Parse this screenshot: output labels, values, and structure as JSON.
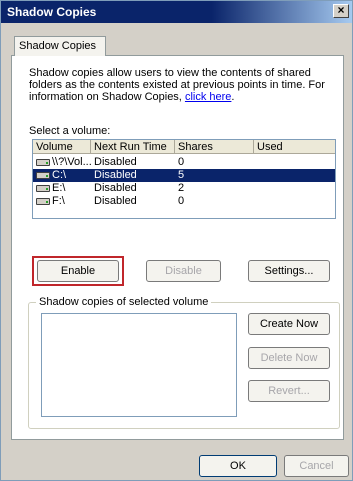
{
  "window": {
    "title": "Shadow Copies",
    "close_glyph": "×"
  },
  "tab": {
    "label": "Shadow Copies"
  },
  "description": {
    "text": "Shadow copies allow users to view the contents of shared folders as the contents existed at previous points in time. For information on Shadow Copies, ",
    "link_text": "click here",
    "suffix": "."
  },
  "volume_section": {
    "label": "Select a volume:",
    "columns": [
      "Volume",
      "Next Run Time",
      "Shares",
      "Used"
    ],
    "rows": [
      {
        "volume": "\\\\?\\Vol...",
        "next_run": "Disabled",
        "shares": "0",
        "used": "",
        "selected": false
      },
      {
        "volume": "C:\\",
        "next_run": "Disabled",
        "shares": "5",
        "used": "",
        "selected": true
      },
      {
        "volume": "E:\\",
        "next_run": "Disabled",
        "shares": "2",
        "used": "",
        "selected": false
      },
      {
        "volume": "F:\\",
        "next_run": "Disabled",
        "shares": "0",
        "used": "",
        "selected": false
      }
    ]
  },
  "buttons": {
    "enable": "Enable",
    "disable": "Disable",
    "settings": "Settings...",
    "create_now": "Create Now",
    "delete_now": "Delete Now",
    "revert": "Revert...",
    "ok": "OK",
    "cancel": "Cancel"
  },
  "shadow_group": {
    "title": "Shadow copies of selected volume"
  },
  "colors": {
    "selection": "#0a246a",
    "highlight_border": "#c0262b"
  }
}
